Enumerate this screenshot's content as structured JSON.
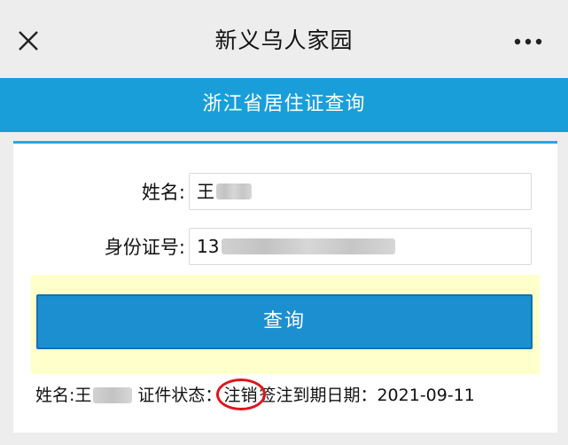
{
  "titlebar": {
    "close_icon": "close-icon",
    "title": "新义乌人家园",
    "more_icon": "more-dots-icon"
  },
  "banner": {
    "title": "浙江省居住证查询",
    "color": "#1a9ed9"
  },
  "form": {
    "name_label": "姓名:",
    "name_value": "王",
    "id_label": "身份证号:",
    "id_value": "13"
  },
  "query_button": {
    "label": "查询",
    "color": "#1b8fd0"
  },
  "result": {
    "name_label": "姓名:",
    "name_value": "王",
    "status_label": "证件状态：",
    "status_value": "注销",
    "expiry_label": "签注到期日期：",
    "expiry_value": "2021-09-11",
    "highlight_color": "#e0141c"
  }
}
